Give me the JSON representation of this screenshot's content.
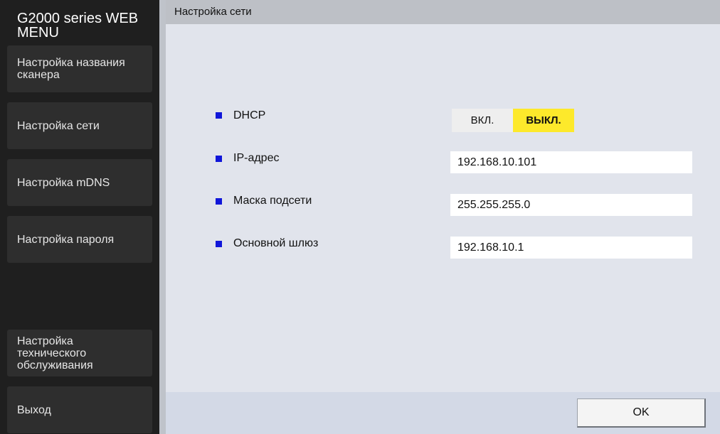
{
  "sidebar": {
    "app_title": "G2000 series WEB MENU",
    "items": [
      {
        "label": "Настройка названия сканера"
      },
      {
        "label": "Настройка сети"
      },
      {
        "label": "Настройка mDNS"
      },
      {
        "label": "Настройка пароля"
      },
      {
        "label": "Настройка технического обслуживания"
      },
      {
        "label": "Выход"
      }
    ]
  },
  "header": {
    "title": "Настройка сети"
  },
  "form": {
    "dhcp": {
      "label": "DHCP",
      "on_label": "ВКЛ.",
      "off_label": "ВЫКЛ.",
      "selected": "ВЫКЛ."
    },
    "ip": {
      "label": "IP-адрес",
      "value": "192.168.10.101"
    },
    "subnet": {
      "label": "Маска подсети",
      "value": "255.255.255.0"
    },
    "gateway": {
      "label": "Основной шлюз",
      "value": "192.168.10.1"
    }
  },
  "footer": {
    "ok_label": "OK"
  },
  "colors": {
    "sidebar_bg": "#1f1f1f",
    "nav_item_bg": "#2e2e2e",
    "content_bg": "#e1e4ec",
    "bullet": "#1016d9",
    "toggle_selected": "#fde92b"
  }
}
